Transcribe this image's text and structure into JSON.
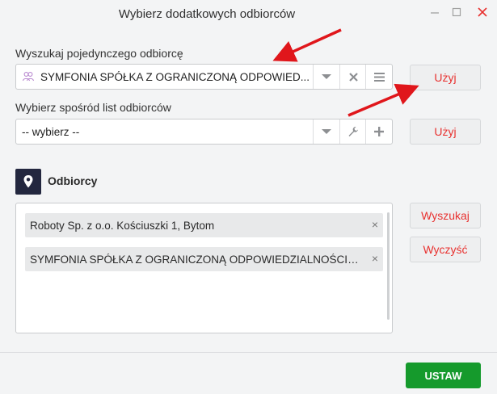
{
  "window": {
    "title": "Wybierz dodatkowych odbiorców"
  },
  "single": {
    "label": "Wyszukaj pojedynczego odbiorcę",
    "value": "SYMFONIA SPÓŁKA Z OGRANICZONĄ ODPOWIED...",
    "use_label": "Użyj"
  },
  "list": {
    "label": "Wybierz spośród list odbiorców",
    "value": "-- wybierz --",
    "use_label": "Użyj"
  },
  "recipients": {
    "title": "Odbiorcy",
    "items": [
      {
        "text": "Roboty Sp. z o.o. Kościuszki 1, Bytom",
        "remove": "×"
      },
      {
        "text": "SYMFONIA SPÓŁKA Z OGRANICZONĄ ODPOWIEDZIALNOŚCIĄ ...",
        "remove": "×"
      }
    ],
    "search_label": "Wyszukaj",
    "clear_label": "Wyczyść"
  },
  "footer": {
    "set_label": "USTAW"
  },
  "colors": {
    "accent_red": "#e8312f",
    "confirm_green": "#159a2c",
    "section_icon_bg": "#23273f",
    "annotation_arrow": "#e0161b"
  },
  "icons": {
    "single_field": [
      "user-group-icon",
      "chevron-down-icon",
      "clear-icon",
      "menu-icon"
    ],
    "list_field": [
      "chevron-down-icon",
      "wrench-icon",
      "plus-icon"
    ],
    "section": "location-pin-icon"
  }
}
